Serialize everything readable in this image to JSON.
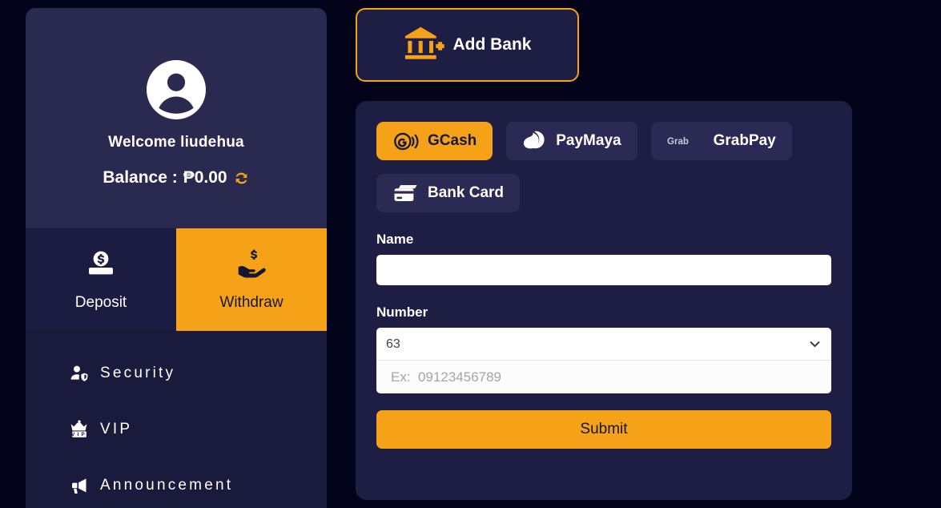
{
  "profile": {
    "avatar_icon": "user-avatar-icon",
    "welcome_text": "Welcome liudehua",
    "balance_label": "Balance :",
    "balance_amount": "₱0.00",
    "refresh_icon": "refresh-icon"
  },
  "tabs": [
    {
      "label": "Deposit",
      "icon": "deposit-coin-icon",
      "active": false
    },
    {
      "label": "Withdraw",
      "icon": "withdraw-hand-icon",
      "active": true
    }
  ],
  "menu": [
    {
      "label": "Security",
      "icon": "user-shield-icon"
    },
    {
      "label": "VIP",
      "icon": "vip-crown-icon"
    },
    {
      "label": "Announcement",
      "icon": "megaphone-icon"
    }
  ],
  "add_bank": {
    "label": "Add Bank",
    "icon": "bank-plus-icon"
  },
  "payment_methods": [
    {
      "label": "GCash",
      "icon": "gcash-icon",
      "selected": true
    },
    {
      "label": "PayMaya",
      "icon": "paymaya-icon",
      "selected": false
    },
    {
      "label": "GrabPay",
      "icon": "grab-icon",
      "selected": false
    },
    {
      "label": "Bank Card",
      "icon": "bank-card-icon",
      "selected": false
    }
  ],
  "form": {
    "name_label": "Name",
    "name_value": "",
    "name_placeholder": "",
    "number_label": "Number",
    "country_code_selected": "63",
    "country_code_options": [
      "63"
    ],
    "number_value": "",
    "number_placeholder": "Ex:  09123456789",
    "submit_label": "Submit"
  },
  "colors": {
    "page_bg": "#03031a",
    "accent": "#f5a219",
    "card_bg": "#2a2a50",
    "panel_bg": "#1e1e45",
    "menu_bg": "#1a1a3c",
    "tab_inactive_bg": "#1c1c42",
    "text": "#ffffff"
  }
}
